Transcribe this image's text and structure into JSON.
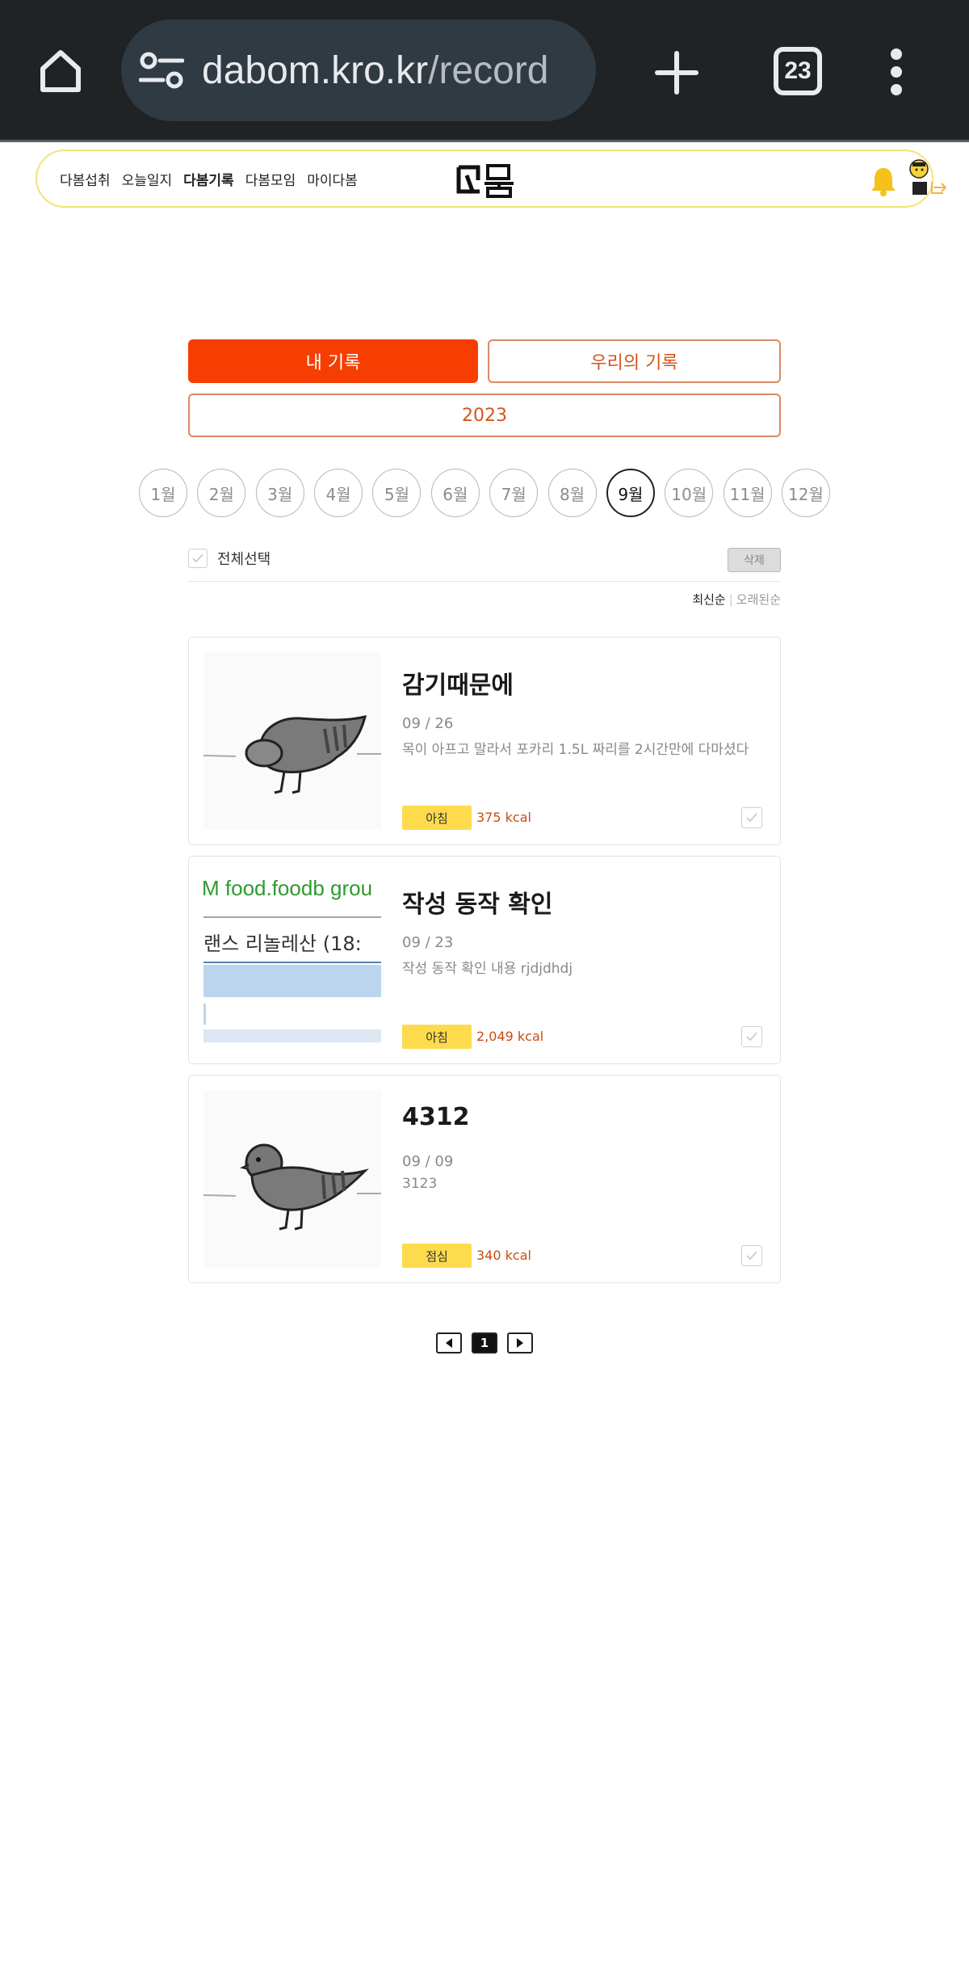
{
  "browser": {
    "url_main": "dabom.kro.kr",
    "url_path": "/record",
    "tab_count": "23"
  },
  "nav": {
    "links": [
      "다봄섭취",
      "오늘일지",
      "다봄기록",
      "다봄모임",
      "마이다봄"
    ],
    "active_index": 2
  },
  "tabs": {
    "my_records": "내 기록",
    "our_records": "우리의 기록"
  },
  "year": "2023",
  "months": [
    "1월",
    "2월",
    "3월",
    "4월",
    "5월",
    "6월",
    "7월",
    "8월",
    "9월",
    "10월",
    "11월",
    "12월"
  ],
  "active_month_index": 8,
  "select_all_label": "전체선택",
  "delete_label": "삭제",
  "sort": {
    "newest": "최신순",
    "oldest": "오래된순"
  },
  "records": [
    {
      "title": "감기때문에",
      "date": "09 / 26",
      "text": "목이 아프고 말라서 포카리 1.5L 짜리를 2시간만에 다마셨다",
      "meal": "아침",
      "kcal": "375 kcal",
      "thumb": "pigeon-bowing"
    },
    {
      "title": "작성 동작 확인",
      "date": "09 / 23",
      "text": "작성 동작 확인 내용 rjdjdhdj",
      "meal": "아침",
      "kcal": "2,049 kcal",
      "thumb": "screenshot",
      "thumb_text_line1": "M food.foodb grou",
      "thumb_text_line2": "랜스 리놀레산 (18:"
    },
    {
      "title": "4312",
      "date": "09 / 09",
      "text": "3123",
      "meal": "점심",
      "kcal": "340 kcal",
      "thumb": "pigeon-standing"
    }
  ],
  "pager": {
    "current": "1"
  },
  "colors": {
    "accent": "#f63e02",
    "outline": "#d5541c",
    "meal_tag": "#fddb4d",
    "nav_border": "#f3e27a"
  }
}
